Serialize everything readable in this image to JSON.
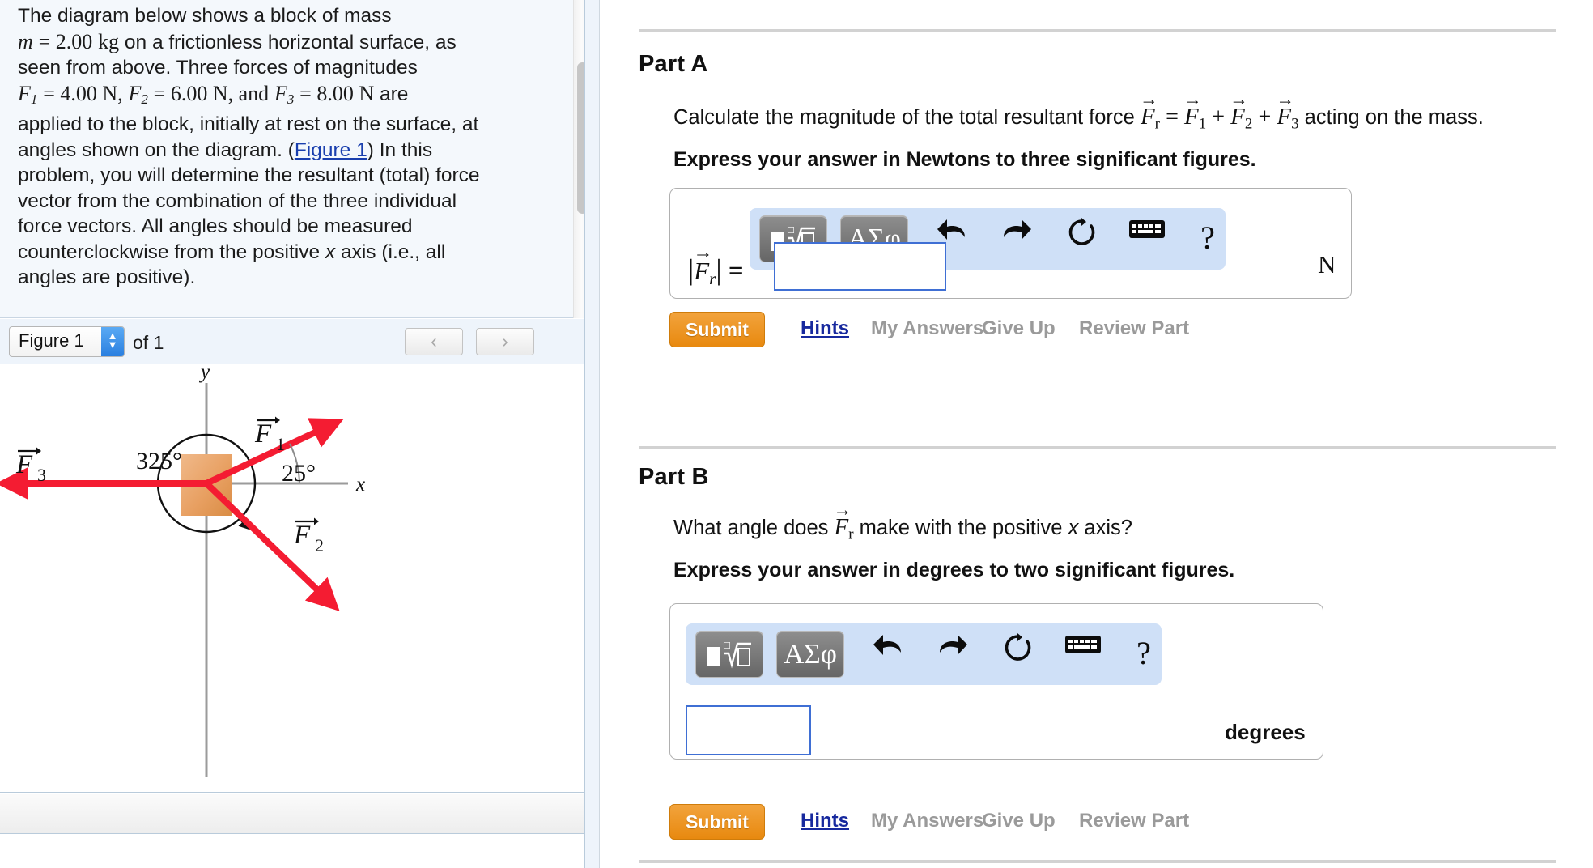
{
  "problem": {
    "line1": "The diagram below shows a block of mass",
    "mass_symbol": "m",
    "mass_eq": "= 2.00",
    "mass_unit": "kg",
    "line2_rest": " on a frictionless horizontal surface, as",
    "line3": "seen from above. Three forces of magnitudes",
    "f1": "F",
    "f1_sub": "1",
    "f1_val": "= 4.00 N,",
    "f2": "F",
    "f2_sub": "2",
    "f2_val": "= 6.00 N, and",
    "f3": "F",
    "f3_sub": "3",
    "f3_val": "= 8.00 N",
    "are": "are",
    "line5": "applied to the block, initially at rest on the surface, at",
    "line6a": "angles shown on the diagram. (",
    "figure_link": "Figure 1",
    "line6b": ") In this",
    "line7": "problem, you will determine the resultant (total) force",
    "line8": "vector from the combination of the three individual",
    "line9": "force vectors. All angles should be measured",
    "line10a": "counterclockwise from the positive ",
    "line10_x": "x",
    "line10b": " axis (i.e., all",
    "line11": "angles are positive)."
  },
  "figure_nav": {
    "selected": "Figure 1",
    "of_label": "of 1",
    "prev_icon": "chevron-left",
    "next_icon": "chevron-right"
  },
  "figure": {
    "axis_x_label": "x",
    "axis_y_label": "y",
    "angle_outer": "325°",
    "angle_inner": "25°",
    "vec1": "F",
    "vec1_sub": "1",
    "vec2": "F",
    "vec2_sub": "2",
    "vec3": "F",
    "vec3_sub": "3",
    "block_color": "#e8a062",
    "vector_color": "#f41c32",
    "axis_color": "#9a9a9a"
  },
  "partA": {
    "title": "Part A",
    "q_pre": "Calculate the magnitude of the total resultant force ",
    "q_fr": "F",
    "q_fr_sub": "r",
    "q_eq": "=",
    "q_f1": "F",
    "q_f1_sub": "1",
    "q_plus1": "+",
    "q_f2": "F",
    "q_f2_sub": "2",
    "q_plus2": "+",
    "q_f3": "F",
    "q_f3_sub": "3",
    "q_post": " acting on the mass.",
    "instruction": "Express your answer in Newtons to three significant figures.",
    "label_fr": "F",
    "label_fr_sub": "r",
    "label_eq": "=",
    "answer_value": "",
    "unit": "N",
    "submit": "Submit",
    "hints": "Hints",
    "my_answers": "My Answers",
    "give_up": "Give Up",
    "review_part": "Review Part"
  },
  "partB": {
    "title": "Part B",
    "q_pre": "What angle does ",
    "q_fr": "F",
    "q_fr_sub": "r",
    "q_mid": " make with the positive ",
    "q_x": "x",
    "q_post": " axis?",
    "instruction": "Express your answer in degrees to two significant figures.",
    "answer_value": "",
    "unit": "degrees",
    "submit": "Submit",
    "hints": "Hints",
    "my_answers": "My Answers",
    "give_up": "Give Up",
    "review_part": "Review Part"
  },
  "toolbar": {
    "template_btn": "template-icon",
    "greek_btn": "ΑΣφ",
    "undo": "undo-icon",
    "redo": "redo-icon",
    "reset": "reset-icon",
    "keyboard": "keyboard-icon",
    "help": "?"
  },
  "colors": {
    "accent_orange": "#e8890f",
    "link_blue": "#17299e",
    "mathbar_blue": "#cfe0f7",
    "input_border": "#3f6fd4",
    "panel_bg": "#f4f8fc"
  }
}
